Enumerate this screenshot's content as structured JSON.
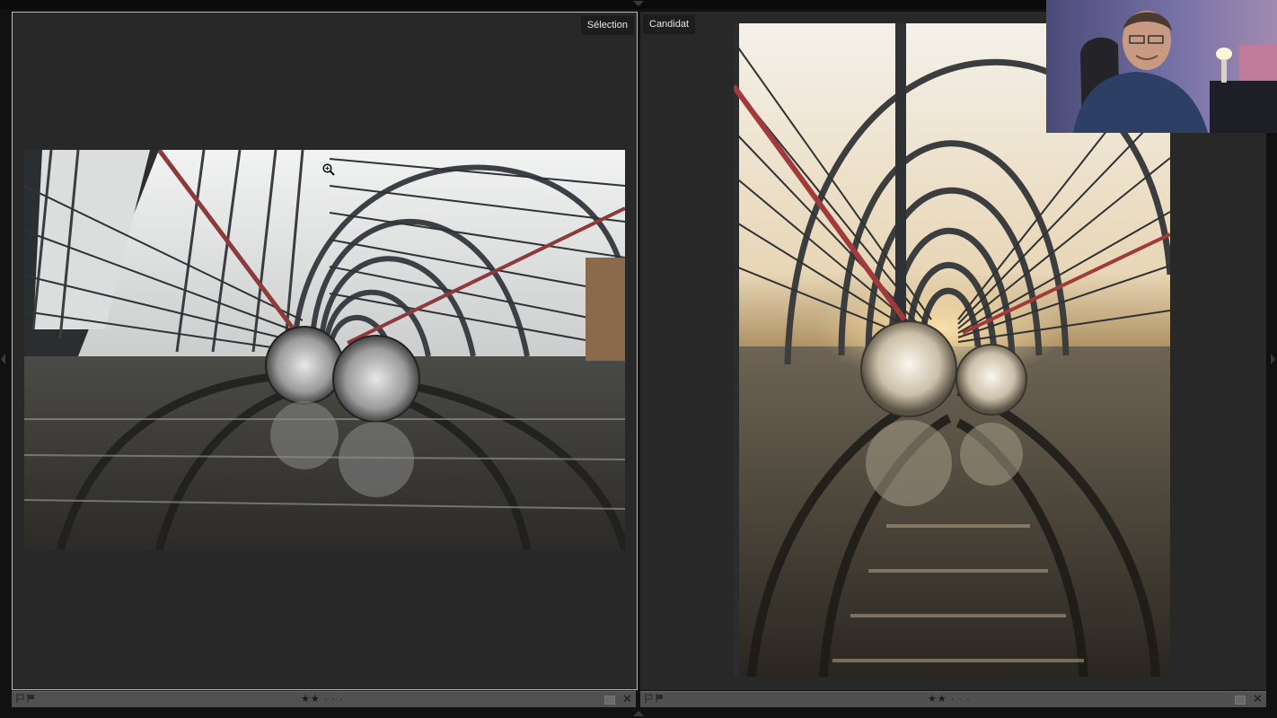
{
  "panes": {
    "left": {
      "label": "Sélection",
      "rating": "★★ · · ·",
      "rating_stars": 2,
      "rating_max": 5
    },
    "right": {
      "label": "Candidat",
      "rating": "★★ · · ·",
      "rating_stars": 2,
      "rating_max": 5
    }
  },
  "icons": {
    "zoom": "zoom-in-icon",
    "flag_unflag": "flag-outline-icon",
    "flag_pick": "flag-icon",
    "color_label": "color-label-icon",
    "close": "close-icon"
  },
  "colors": {
    "panel_bg": "#282828",
    "frame_bg": "#111111",
    "status_bar": "#505050",
    "label_bg": "#1d1d1d",
    "selection_border": "#bdbdbd"
  }
}
